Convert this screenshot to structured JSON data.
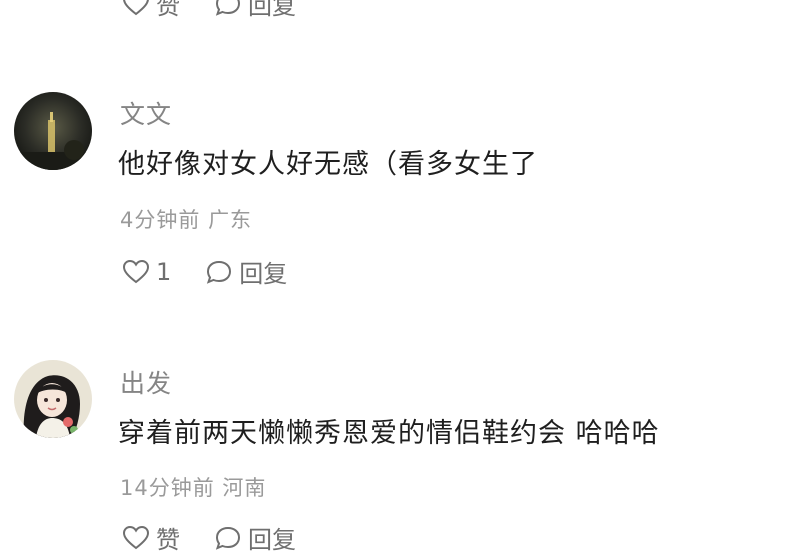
{
  "top_actions": {
    "like_label": "赞",
    "reply_label": "回复"
  },
  "comments": [
    {
      "username": "文文",
      "content": "他好像对女人好无感（看多女生了",
      "time": "4分钟前",
      "location": "广东",
      "like_label": "1",
      "reply_label": "回复",
      "avatar_icon": "night-tower-avatar"
    },
    {
      "username": "出发",
      "content": "穿着前两天懒懒秀恩爱的情侣鞋约会 哈哈哈",
      "time": "14分钟前",
      "location": "河南",
      "like_label": "赞",
      "reply_label": "回复",
      "avatar_icon": "anime-girl-avatar"
    }
  ],
  "icons": {
    "like": "heart-icon",
    "reply": "speech-bubble-icon"
  }
}
